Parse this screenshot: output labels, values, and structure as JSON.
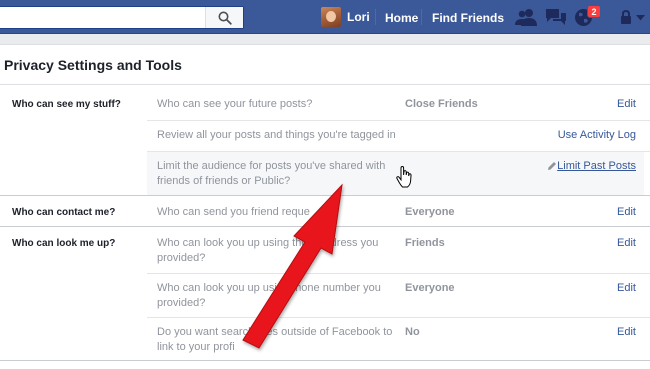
{
  "topbar": {
    "search": {
      "value": "",
      "placeholder": ""
    },
    "user_name": "Lori",
    "home_label": "Home",
    "find_friends_label": "Find Friends",
    "notifications_count": "2",
    "icons": [
      "search-icon",
      "friend-requests-icon",
      "messages-icon",
      "notifications-globe-icon",
      "lock-icon",
      "dropdown-arrow-icon"
    ]
  },
  "page": {
    "title": "Privacy Settings and Tools"
  },
  "sections": [
    {
      "label": "Who can see my stuff?",
      "rows": [
        {
          "question": "Who can see your future posts?",
          "value": "Close Friends",
          "action": "Edit"
        },
        {
          "question": "Review all your posts and things you're tagged in",
          "value": "",
          "action": "Use Activity Log"
        },
        {
          "question": "Limit the audience for posts you've shared with friends of friends or Public?",
          "value": "",
          "action": "Limit Past Posts"
        }
      ]
    },
    {
      "label": "Who can contact me?",
      "rows": [
        {
          "question": "Who can send you friend reque",
          "value": "Everyone",
          "action": "Edit"
        }
      ]
    },
    {
      "label": "Who can look me up?",
      "rows": [
        {
          "question": "Who can look you up using the     il address you provided?",
          "value": "Friends",
          "action": "Edit"
        },
        {
          "question": "Who can look you up usi       e phone number you provided?",
          "value": "Everyone",
          "action": "Edit"
        },
        {
          "question": "Do you want search      mes outside of Facebook to link to your profi",
          "value": "No",
          "action": "Edit"
        }
      ]
    }
  ],
  "colors": {
    "topbar": "#3b5998",
    "link": "#365899",
    "annotation_arrow": "#e8161c",
    "badge": "#fa3e3e"
  }
}
